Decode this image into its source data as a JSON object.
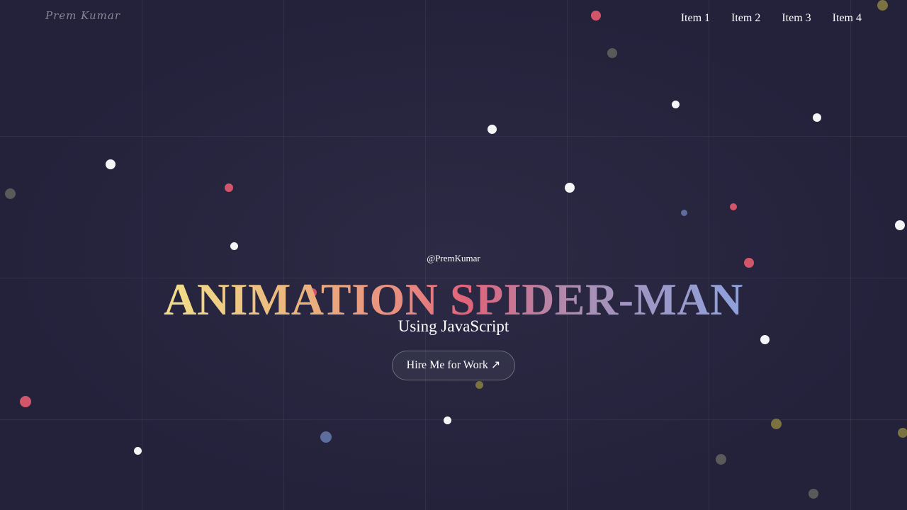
{
  "header": {
    "logo_text": "Prem Kumar",
    "nav": [
      {
        "label": "Item 1"
      },
      {
        "label": "Item 2"
      },
      {
        "label": "Item 3"
      },
      {
        "label": "Item 4"
      }
    ]
  },
  "hero": {
    "handle": "@PremKumar",
    "title": "ANIMATION SPIDER-MAN",
    "subtitle": "Using JavaScript",
    "cta_label": "Hire Me for Work ↗"
  },
  "colors": {
    "background": "#24223b",
    "gradient": [
      "#f2df8a",
      "#e0637a",
      "#8ea2dd"
    ],
    "particles": [
      "#f5f5f5",
      "#d1566a",
      "#5c6d9e",
      "#7a7240",
      "#5a5a5a"
    ]
  }
}
